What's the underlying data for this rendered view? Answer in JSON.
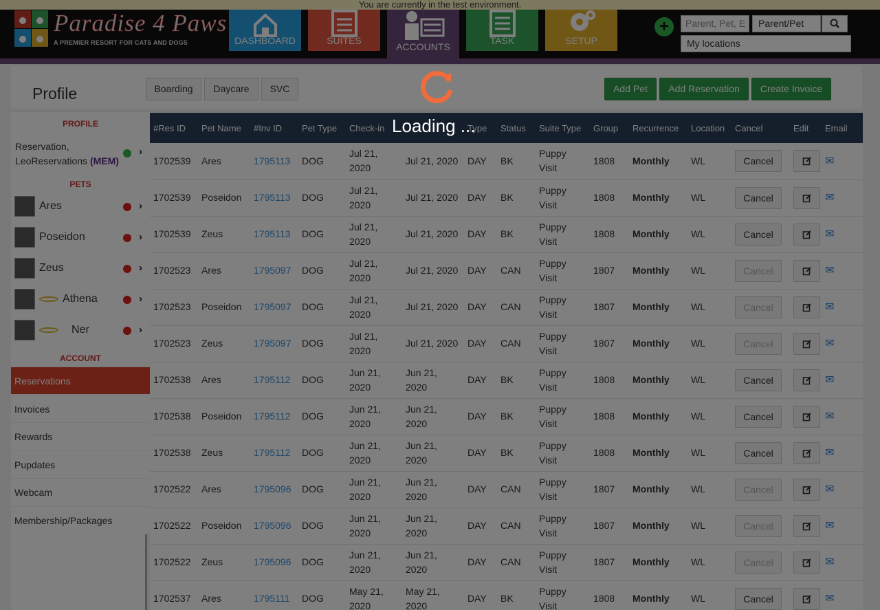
{
  "env_notice": "You are currently in the test environment.",
  "brand": {
    "title": "Paradise 4 Paws",
    "tagline": "A PREMIER RESORT FOR CATS AND DOGS"
  },
  "nav": [
    {
      "label": "DASHBOARD",
      "icon": "house-icon",
      "color": "#2a9fe0"
    },
    {
      "label": "SUITES",
      "icon": "clipboard-list-icon",
      "color": "#e1553f"
    },
    {
      "label": "ACCOUNTS",
      "icon": "id-card-icon",
      "color": "#6b4b78"
    },
    {
      "label": "TASK",
      "icon": "notepad-icon",
      "color": "#3aa655"
    },
    {
      "label": "SETUP",
      "icon": "gears-icon",
      "color": "#e3ae2b"
    }
  ],
  "search": {
    "placeholder": "Parent, Pet, E",
    "type_value": "Parent/Pet",
    "location_value": "My locations"
  },
  "profile": {
    "title": "Profile"
  },
  "tabs": [
    "Boarding",
    "Daycare",
    "SVC"
  ],
  "actions": [
    "Add Pet",
    "Add Reservation",
    "Create Invoice"
  ],
  "sidebar": {
    "profile_heading": "PROFILE",
    "reservation_line": "Reservation, LeoReservations",
    "membership_badge": "(MEM)",
    "pets_heading": "PETS",
    "pets": [
      "Ares",
      "Poseidon",
      "Zeus",
      "Athena",
      "Ner"
    ],
    "account_heading": "ACCOUNT",
    "menu": [
      "Reservations",
      "Invoices",
      "Rewards",
      "Pupdates",
      "Webcam",
      "Membership/Packages"
    ]
  },
  "table": {
    "headers": [
      "#Res ID",
      "Pet Name",
      "#Inv ID",
      "Pet Type",
      "Check-in",
      "",
      "Type",
      "Status",
      "Suite Type",
      "Group",
      "Recurrence",
      "Location",
      "Cancel",
      "Edit",
      "Email"
    ],
    "rows": [
      [
        "1702539",
        "Ares",
        "1795113",
        "DOG",
        "Jul 21, 2020",
        "Jul 21, 2020",
        "DAY",
        "BK",
        "Puppy Visit",
        "1808",
        "Monthly",
        "WL",
        "Cancel"
      ],
      [
        "1702539",
        "Poseidon",
        "1795113",
        "DOG",
        "Jul 21, 2020",
        "Jul 21, 2020",
        "DAY",
        "BK",
        "Puppy Visit",
        "1808",
        "Monthly",
        "WL",
        "Cancel"
      ],
      [
        "1702539",
        "Zeus",
        "1795113",
        "DOG",
        "Jul 21, 2020",
        "Jul 21, 2020",
        "DAY",
        "BK",
        "Puppy Visit",
        "1808",
        "Monthly",
        "WL",
        "Cancel"
      ],
      [
        "1702523",
        "Ares",
        "1795097",
        "DOG",
        "Jul 21, 2020",
        "Jul 21, 2020",
        "DAY",
        "CAN",
        "Puppy Visit",
        "1807",
        "Monthly",
        "WL",
        "Cancel"
      ],
      [
        "1702523",
        "Poseidon",
        "1795097",
        "DOG",
        "Jul 21, 2020",
        "Jul 21, 2020",
        "DAY",
        "CAN",
        "Puppy Visit",
        "1807",
        "Monthly",
        "WL",
        "Cancel"
      ],
      [
        "1702523",
        "Zeus",
        "1795097",
        "DOG",
        "Jul 21, 2020",
        "Jul 21, 2020",
        "DAY",
        "CAN",
        "Puppy Visit",
        "1807",
        "Monthly",
        "WL",
        "Cancel"
      ],
      [
        "1702538",
        "Ares",
        "1795112",
        "DOG",
        "Jun 21, 2020",
        "Jun 21, 2020",
        "DAY",
        "BK",
        "Puppy Visit",
        "1808",
        "Monthly",
        "WL",
        "Cancel"
      ],
      [
        "1702538",
        "Poseidon",
        "1795112",
        "DOG",
        "Jun 21, 2020",
        "Jun 21, 2020",
        "DAY",
        "BK",
        "Puppy Visit",
        "1808",
        "Monthly",
        "WL",
        "Cancel"
      ],
      [
        "1702538",
        "Zeus",
        "1795112",
        "DOG",
        "Jun 21, 2020",
        "Jun 21, 2020",
        "DAY",
        "BK",
        "Puppy Visit",
        "1808",
        "Monthly",
        "WL",
        "Cancel"
      ],
      [
        "1702522",
        "Ares",
        "1795096",
        "DOG",
        "Jun 21, 2020",
        "Jun 21, 2020",
        "DAY",
        "CAN",
        "Puppy Visit",
        "1807",
        "Monthly",
        "WL",
        "Cancel"
      ],
      [
        "1702522",
        "Poseidon",
        "1795096",
        "DOG",
        "Jun 21, 2020",
        "Jun 21, 2020",
        "DAY",
        "CAN",
        "Puppy Visit",
        "1807",
        "Monthly",
        "WL",
        "Cancel"
      ],
      [
        "1702522",
        "Zeus",
        "1795096",
        "DOG",
        "Jun 21, 2020",
        "Jun 21, 2020",
        "DAY",
        "CAN",
        "Puppy Visit",
        "1807",
        "Monthly",
        "WL",
        "Cancel"
      ],
      [
        "1702537",
        "Ares",
        "1795111",
        "DOG",
        "May 21, 2020",
        "May 21, 2020",
        "DAY",
        "BK",
        "Puppy Visit",
        "1808",
        "Monthly",
        "WL",
        "Cancel"
      ]
    ]
  },
  "loading": {
    "text": "Loading ...",
    "icon": "refresh-spinner-icon"
  },
  "colors": {
    "header_bg": "#111111",
    "accent_purple": "#6b4b78",
    "table_header": "#2a3e58",
    "green_button": "#2e9b49",
    "active_menu": "#d9432f",
    "link": "#3f8dd1"
  }
}
